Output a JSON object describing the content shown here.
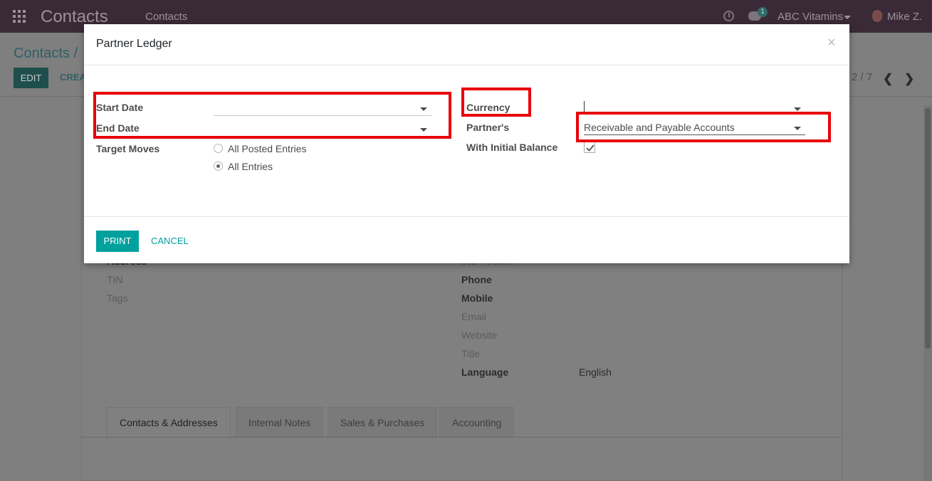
{
  "navbar": {
    "app_title": "Contacts",
    "menu_item": "Contacts",
    "messages_badge": "1",
    "company": "ABC Vitamins",
    "user": "Mike Z."
  },
  "control_panel": {
    "breadcrumb": "Contacts /",
    "edit_label": "EDIT",
    "create_label": "CREA",
    "pager_text": "2 / 7"
  },
  "form_background": {
    "left_labels": [
      "Address",
      "TIN",
      "Tags"
    ],
    "right_fields": [
      {
        "label": "Job Position",
        "value": "",
        "bold": false
      },
      {
        "label": "Phone",
        "value": "",
        "bold": true
      },
      {
        "label": "Mobile",
        "value": "",
        "bold": true
      },
      {
        "label": "Email",
        "value": "",
        "bold": false
      },
      {
        "label": "Website",
        "value": "",
        "bold": false
      },
      {
        "label": "Title",
        "value": "",
        "bold": false
      },
      {
        "label": "Language",
        "value": "English",
        "bold": true
      }
    ],
    "tabs": [
      "Contacts & Addresses",
      "Internal Notes",
      "Sales & Purchases",
      "Accounting"
    ],
    "active_tab": "Contacts & Addresses"
  },
  "modal": {
    "title": "Partner Ledger",
    "close_glyph": "×",
    "start_date_label": "Start Date",
    "start_date_value": "",
    "end_date_label": "End Date",
    "end_date_value": "",
    "target_moves_label": "Target Moves",
    "target_moves_options": [
      "All Posted Entries",
      "All Entries"
    ],
    "target_moves_selected": "All Entries",
    "currency_label": "Currency",
    "currency_value": "",
    "partners_label": "Partner's",
    "partners_value": "Receivable and Payable Accounts",
    "initial_balance_label": "With Initial Balance",
    "initial_balance_checked": true,
    "print_label": "PRINT",
    "cancel_label": "CANCEL"
  },
  "colors": {
    "navbar": "#3a2a38",
    "primary": "#00a09d",
    "highlight": "#e8000a"
  }
}
